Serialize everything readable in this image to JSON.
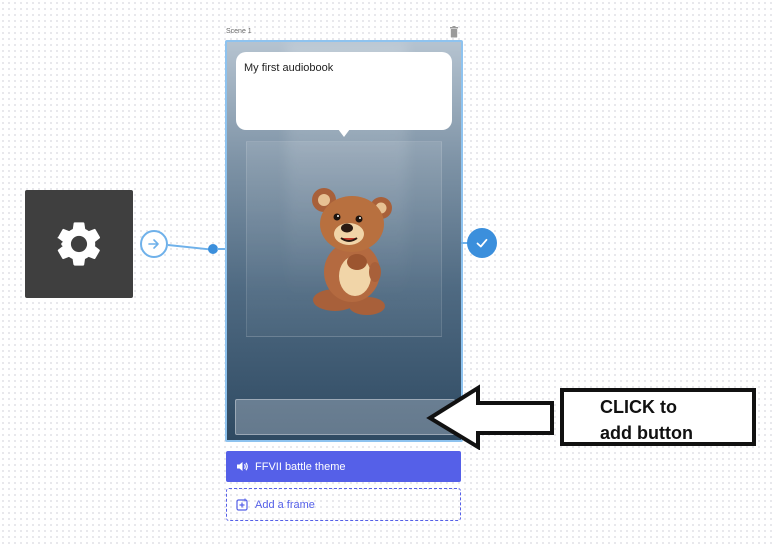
{
  "scene": {
    "label": "Scene 1",
    "speech_text": "My first audiobook"
  },
  "audio_button": {
    "label": "FFVII battle theme"
  },
  "add_frame": {
    "label": "Add a frame"
  },
  "callout": {
    "line1": "CLICK to",
    "line2": "add button"
  },
  "icons": {
    "settings": "gear-icon",
    "connector": "arrow-right-circle-icon",
    "trash": "trash-icon",
    "check": "check-icon",
    "speaker": "speaker-icon",
    "add_frame": "add-frame-icon"
  },
  "colors": {
    "accent": "#5560e8",
    "connector": "#3b8fdc"
  }
}
